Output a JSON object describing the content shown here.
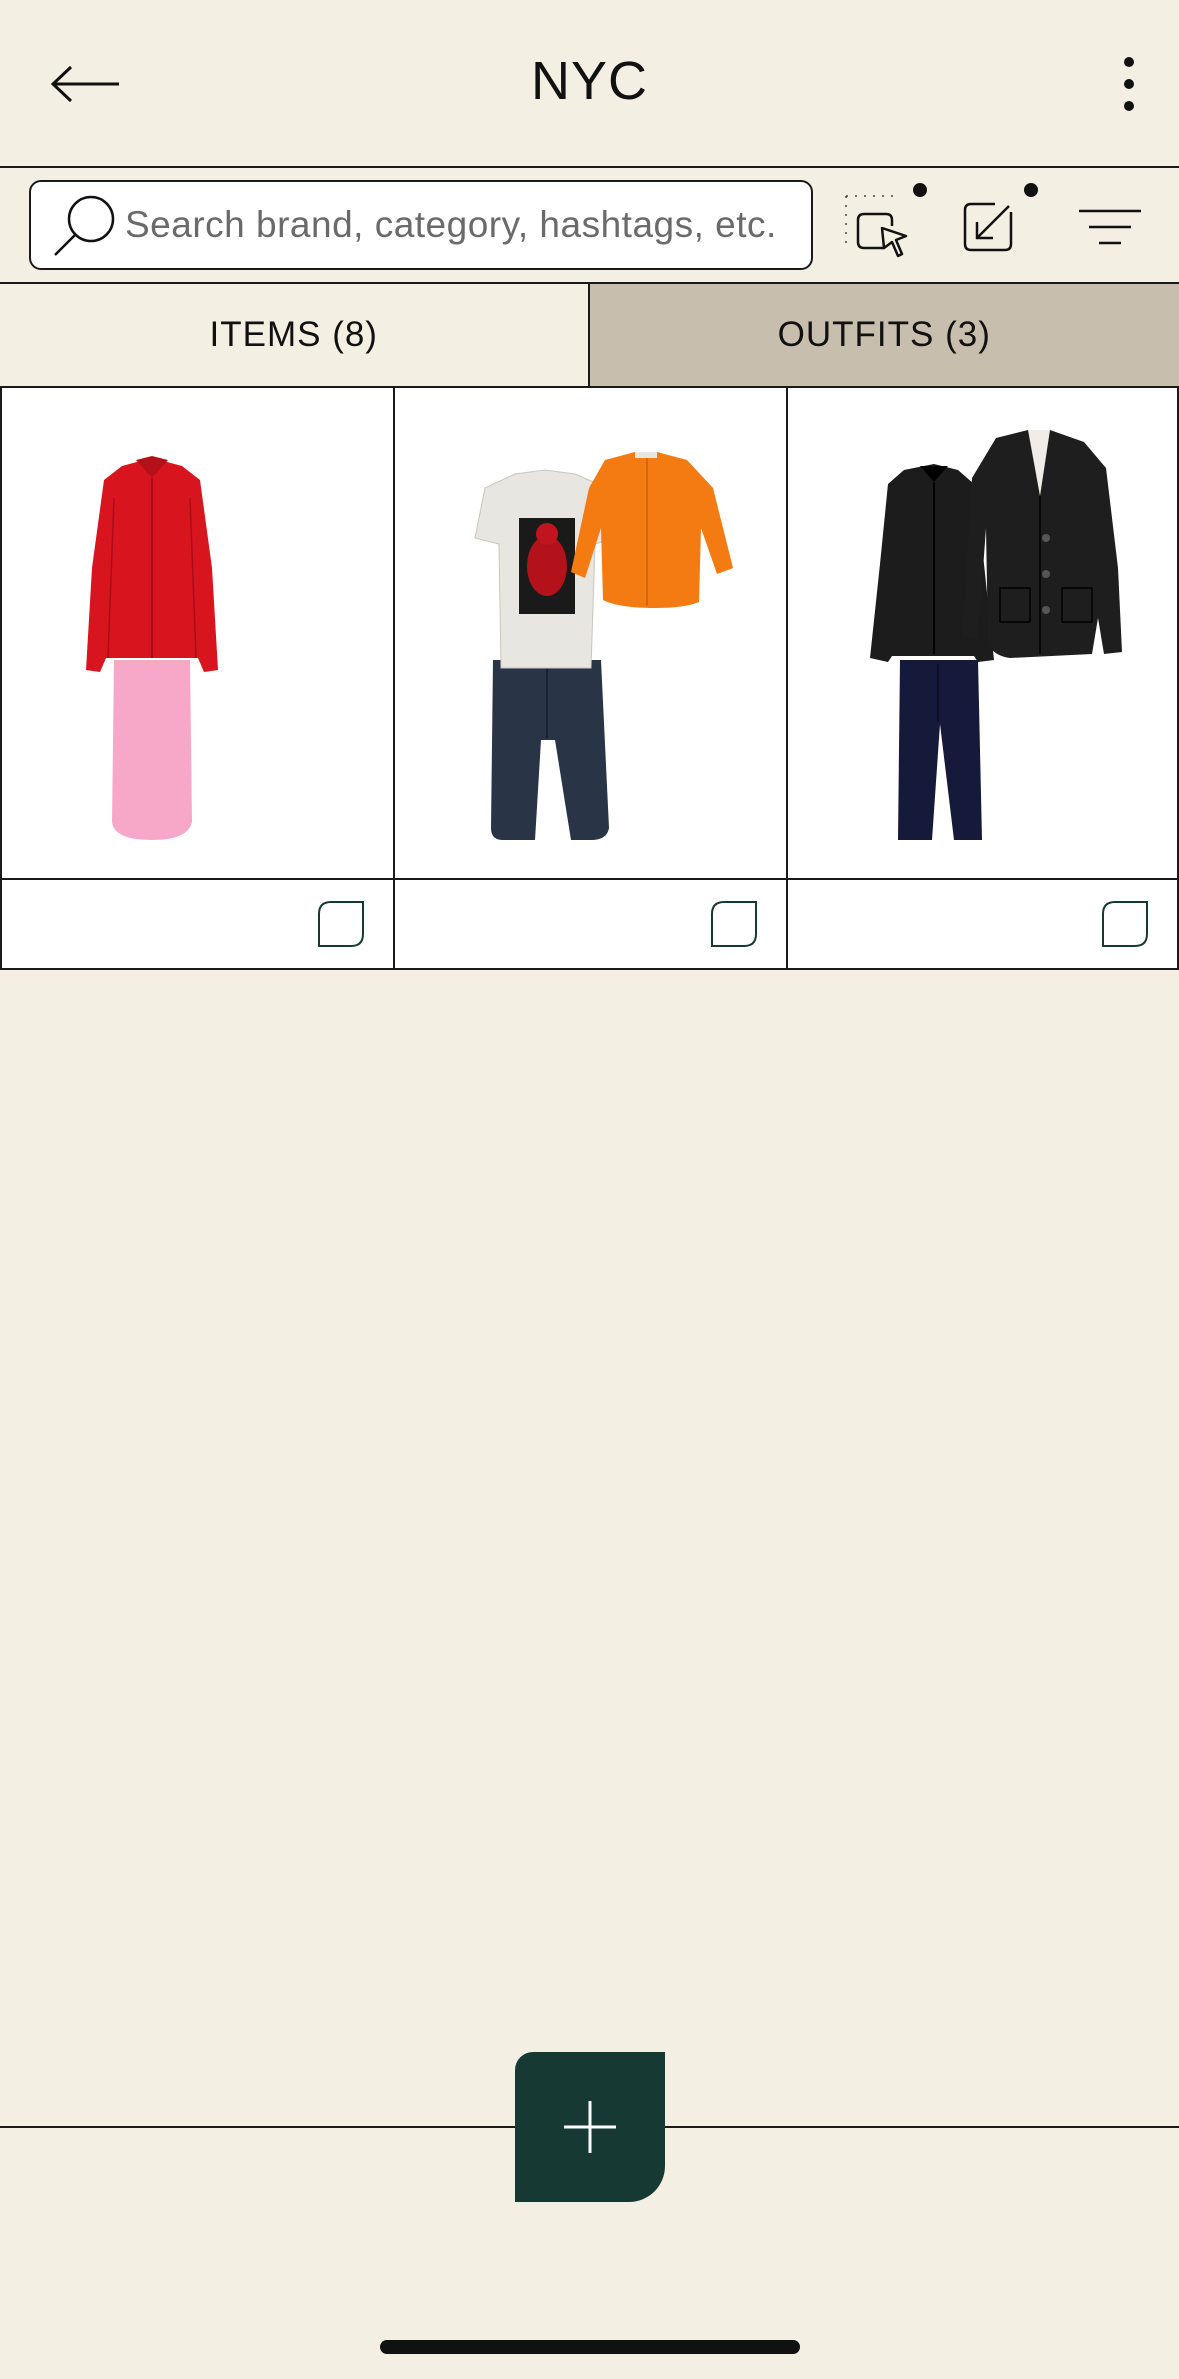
{
  "header": {
    "title": "NYC",
    "back_icon": "arrow-left-icon",
    "more_icon": "vertical-dots-icon"
  },
  "toolbar": {
    "search_placeholder": "Search brand, category, hashtags, etc.",
    "search_icon": "magnifier-icon",
    "select_icon": "select-cursor-icon",
    "share_icon": "share-arrow-icon",
    "filter_icon": "filter-lines-icon"
  },
  "tabs": [
    {
      "label": "ITEMS (8)",
      "active": false
    },
    {
      "label": "OUTFITS (3)",
      "active": true
    }
  ],
  "outfits": [
    {
      "description": "red shirt with pink skirt",
      "note_icon": "note-icon"
    },
    {
      "description": "graphic t-shirt, orange cardigan, dark jeans",
      "note_icon": "note-icon"
    },
    {
      "description": "black shirt, black blazer, navy trousers",
      "note_icon": "note-icon"
    }
  ],
  "fab": {
    "icon": "plus-icon"
  },
  "colors": {
    "background": "#F3EFE3",
    "active_tab": "#C8BEAD",
    "fab": "#163A33",
    "border": "#1a1a1a"
  }
}
